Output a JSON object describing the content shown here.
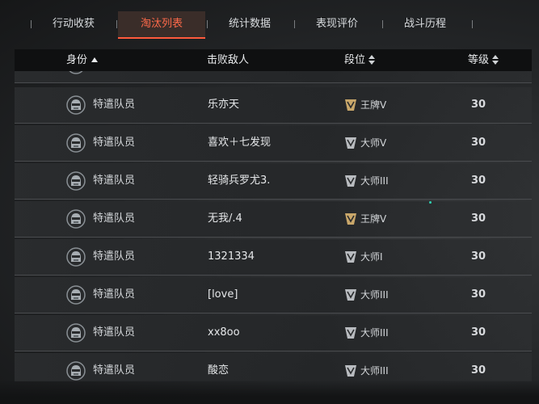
{
  "tabs": [
    {
      "label": "行动收获",
      "active": false
    },
    {
      "label": "淘汰列表",
      "active": true
    },
    {
      "label": "统计数据",
      "active": false
    },
    {
      "label": "表现评价",
      "active": false
    },
    {
      "label": "战斗历程",
      "active": false
    }
  ],
  "table": {
    "headers": {
      "identity": "身份",
      "defeated": "击败敌人",
      "rank": "段位",
      "level": "等级"
    },
    "sort_column": "identity",
    "sort_direction": "ascending",
    "rows": [
      {
        "identity": "特遣队员",
        "defeated": "乐亦天",
        "rank": "王牌V",
        "rank_icon": "ace-rank-icon",
        "level": "30"
      },
      {
        "identity": "特遣队员",
        "defeated": "喜欢＋七发现",
        "rank": "大师V",
        "rank_icon": "master-rank-icon",
        "level": "30"
      },
      {
        "identity": "特遣队员",
        "defeated": "轻骑兵罗尤3.",
        "rank": "大师III",
        "rank_icon": "master-rank-icon",
        "level": "30"
      },
      {
        "identity": "特遣队员",
        "defeated": "无我/.4",
        "rank": "王牌V",
        "rank_icon": "ace-rank-icon",
        "level": "30"
      },
      {
        "identity": "特遣队员",
        "defeated": "1321334",
        "rank": "大师I",
        "rank_icon": "master-rank-icon",
        "level": "30"
      },
      {
        "identity": "特遣队员",
        "defeated": "[love]",
        "rank": "大师III",
        "rank_icon": "master-rank-icon",
        "level": "30"
      },
      {
        "identity": "特遣队员",
        "defeated": "xx8oo",
        "rank": "大师III",
        "rank_icon": "master-rank-icon",
        "level": "30"
      },
      {
        "identity": "特遣队员",
        "defeated": "酸恋",
        "rank": "大师III",
        "rank_icon": "master-rank-icon",
        "level": "30"
      }
    ]
  },
  "colors": {
    "accent": "#ff5a3c",
    "header_bg": "#0f1011",
    "row_bg": "#2a2c2e"
  }
}
